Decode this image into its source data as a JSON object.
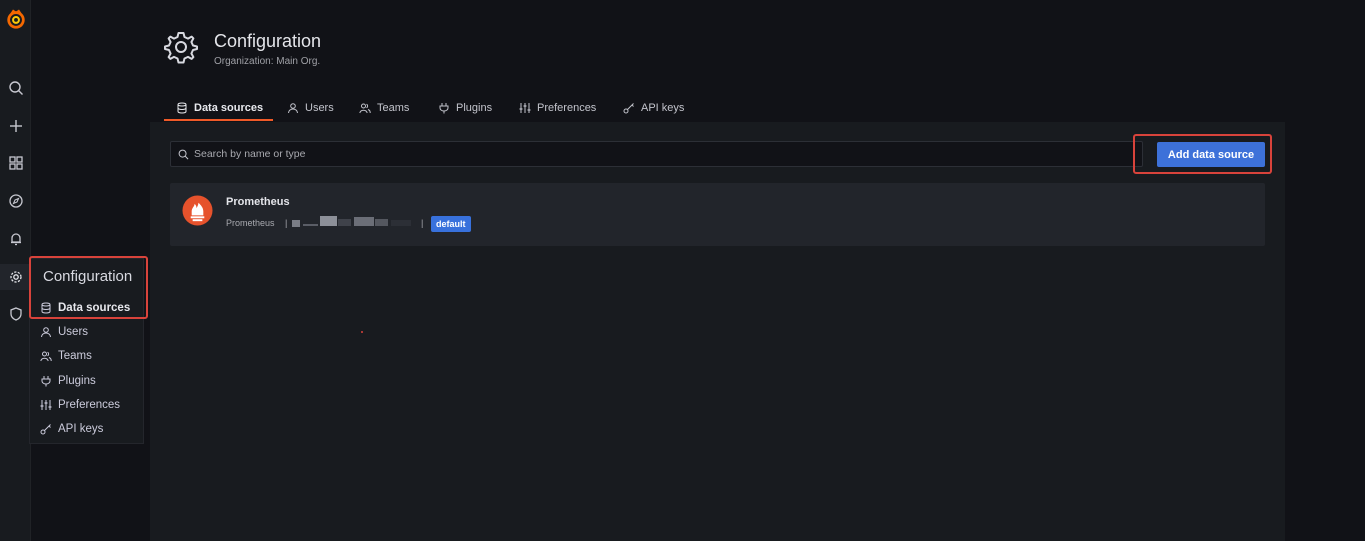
{
  "colors": {
    "accent": "#f05a28",
    "primary_button": "#3d71d9",
    "highlight_border": "#d8433b",
    "prometheus": "#e6522c"
  },
  "sidebar": {
    "icons": [
      "grafana-logo-icon",
      "search-icon",
      "plus-icon",
      "dashboards-icon",
      "explore-icon",
      "alerting-icon",
      "configuration-gear-icon",
      "shield-icon"
    ]
  },
  "flyout": {
    "title": "Configuration",
    "items": [
      {
        "label": "Data sources",
        "icon": "database-icon"
      },
      {
        "label": "Users",
        "icon": "user-icon"
      },
      {
        "label": "Teams",
        "icon": "users-icon"
      },
      {
        "label": "Plugins",
        "icon": "plug-icon"
      },
      {
        "label": "Preferences",
        "icon": "sliders-icon"
      },
      {
        "label": "API keys",
        "icon": "key-icon"
      }
    ]
  },
  "header": {
    "title": "Configuration",
    "subtitle": "Organization: Main Org."
  },
  "tabs": [
    {
      "label": "Data sources",
      "icon": "database-icon",
      "active": true
    },
    {
      "label": "Users",
      "icon": "user-icon"
    },
    {
      "label": "Teams",
      "icon": "users-icon"
    },
    {
      "label": "Plugins",
      "icon": "plug-icon"
    },
    {
      "label": "Preferences",
      "icon": "sliders-icon"
    },
    {
      "label": "API keys",
      "icon": "key-icon"
    }
  ],
  "search": {
    "placeholder": "Search by name or type"
  },
  "actions": {
    "add_label": "Add data source"
  },
  "datasources": [
    {
      "name": "Prometheus",
      "type": "Prometheus",
      "separator": "|",
      "badge": "default"
    }
  ]
}
